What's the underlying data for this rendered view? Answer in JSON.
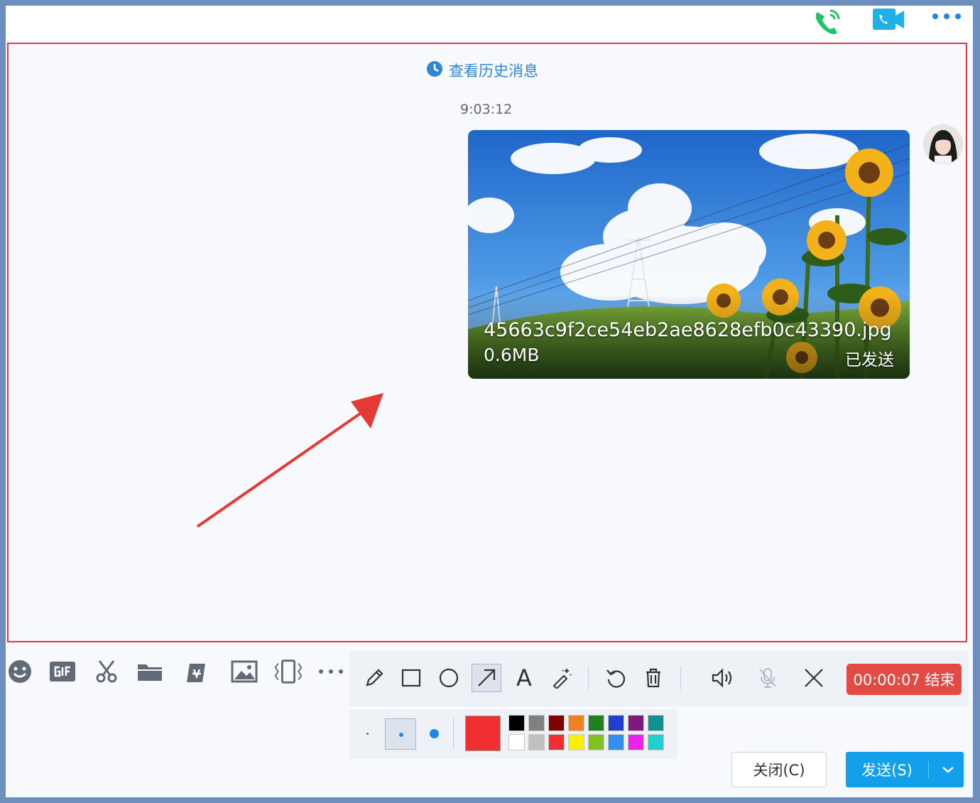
{
  "history": {
    "label": "查看历史消息"
  },
  "message": {
    "time": "9:03:12",
    "file_name": "45663c9f2ce54eb2ae8628efb0c43390.jpg",
    "file_size": "0.6MB",
    "status": "已发送"
  },
  "header_icons": [
    "phone-icon",
    "video-call-icon",
    "more-icon"
  ],
  "chat_toolbar_icons": [
    "emoji-icon",
    "gif-icon",
    "scissors-icon",
    "folder-icon",
    "red-packet-icon",
    "image-icon",
    "shake-icon",
    "more-icon"
  ],
  "draw_tools": [
    "pencil-icon",
    "rectangle-icon",
    "circle-icon",
    "arrow-icon",
    "text-icon",
    "magic-wand-icon",
    "undo-icon",
    "trash-icon",
    "speaker-icon",
    "mic-off-icon",
    "close-icon"
  ],
  "draw_tools_text": {
    "text_tool": "A"
  },
  "recording": {
    "label": "00:00:07 结束"
  },
  "palette": {
    "current": "#f03030",
    "top": [
      "#000000",
      "#808080",
      "#800000",
      "#f08020",
      "#208020",
      "#2040d0",
      "#801880",
      "#109090"
    ],
    "bottom": [
      "#ffffff",
      "#c0c0c0",
      "#f03030",
      "#f8f000",
      "#80c020",
      "#3090f0",
      "#f020f0",
      "#20d0d0"
    ]
  },
  "buttons": {
    "close": "关闭(C)",
    "send": "发送(S)"
  },
  "colors": {
    "accent": "#12a0ec",
    "record_red": "#e34a44",
    "annotation": "#e53935",
    "link": "#2f86d6"
  }
}
